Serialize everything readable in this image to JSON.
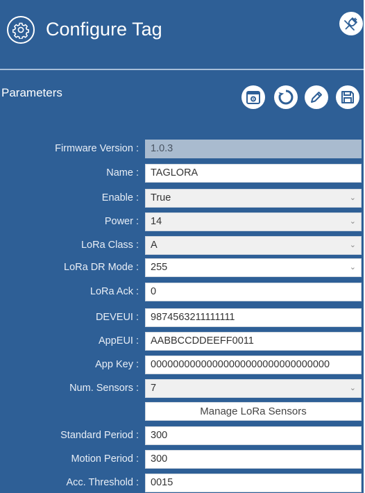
{
  "header": {
    "title": "Configure Tag",
    "icon": "gear-icon",
    "action_icon": "unplug-icon"
  },
  "parameters": {
    "label": "Parameters",
    "tools": [
      "calendar-settings-icon",
      "refresh-icon",
      "edit-icon",
      "save-icon"
    ]
  },
  "fields": {
    "firmware": {
      "label": "Firmware Version :",
      "value": "1.0.3"
    },
    "name": {
      "label": "Name :",
      "value": "TAGLORA"
    },
    "enable": {
      "label": "Enable :",
      "value": "True"
    },
    "power": {
      "label": "Power :",
      "value": "14"
    },
    "lora_class": {
      "label": "LoRa Class :",
      "value": "A"
    },
    "lora_dr_mode": {
      "label": "LoRa DR Mode :",
      "value": "255"
    },
    "lora_ack": {
      "label": "LoRa Ack :",
      "value": "0"
    },
    "deveui": {
      "label": "DEVEUI :",
      "value": "9874563211111111"
    },
    "appeui": {
      "label": "AppEUI :",
      "value": "AABBCCDDEEFF0011"
    },
    "app_key": {
      "label": "App Key :",
      "value": "00000000000000000000000000000000"
    },
    "num_sensors": {
      "label": "Num. Sensors :",
      "value": "7"
    },
    "standard_period": {
      "label": "Standard Period :",
      "value": "300"
    },
    "motion_period": {
      "label": "Motion Period :",
      "value": "300"
    },
    "acc_threshold": {
      "label": "Acc. Threshold :",
      "value": "0015"
    }
  },
  "manage_sensors": {
    "label": "Manage LoRa Sensors"
  },
  "colors": {
    "panel_bg": "#2e5f96",
    "readonly_bg": "#a9bbcf",
    "divider": "#a9bfd9"
  }
}
